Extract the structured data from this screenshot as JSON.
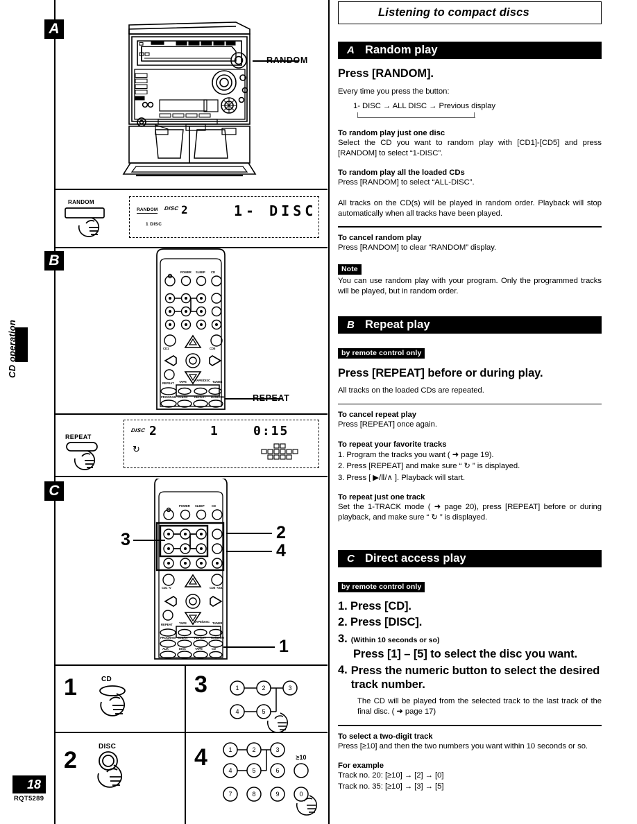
{
  "page": {
    "number": "18",
    "code": "RQT5289",
    "side_label": "CD operation",
    "title": "Listening to compact discs"
  },
  "figures": {
    "a": {
      "letter": "A",
      "callout": "RANDOM",
      "display": {
        "button_label": "RANDOM",
        "indicator": "RANDOM",
        "disc_label": "DISC",
        "disc_number": "2",
        "sub_label": "1 DISC",
        "readout": "1- DISC"
      }
    },
    "b": {
      "letter": "B",
      "callout": "REPEAT",
      "display": {
        "button_label": "REPEAT",
        "disc_label": "DISC",
        "disc_number": "2",
        "track": "1",
        "time": "0:15"
      }
    },
    "c": {
      "letter": "C",
      "markers": [
        "1",
        "2",
        "3",
        "4"
      ]
    },
    "steps": [
      {
        "num": "1",
        "label": "CD"
      },
      {
        "num": "2",
        "label": "DISC"
      },
      {
        "num": "3",
        "label": "",
        "keys": [
          "1",
          "2",
          "3",
          "4",
          "5"
        ]
      },
      {
        "num": "4",
        "label": "",
        "keys": [
          "1",
          "2",
          "3",
          "4",
          "5",
          "6",
          "7",
          "8",
          "9",
          "0"
        ],
        "over10": "≥10"
      }
    ]
  },
  "sections": {
    "random": {
      "letter": "A",
      "name": "Random play",
      "heading": "Press [RANDOM].",
      "intro": "Every time you press the button:",
      "cycle": "1- DISC → ALL DISC → Previous display",
      "sub1_head": "To random play just one  disc",
      "sub1_body": "Select the CD you want to random play with [CD1]-[CD5] and press [RANDOM] to select “1-DISC”.",
      "sub2_head": "To random play all the loaded CDs",
      "sub2_body": "Press [RANDOM] to select “ALL-DISC”.",
      "body3": "All tracks on the CD(s) will be played in random order. Playback will stop automatically when all tracks have been played.",
      "sub3_head": "To cancel random play",
      "sub3_body": "Press [RANDOM] to clear “RANDOM” display.",
      "note_tag": "Note",
      "note_body": "You can use random play with your program. Only the programmed tracks will be played, but in random order."
    },
    "repeat": {
      "letter": "B",
      "name": "Repeat play",
      "tag": "by remote control only",
      "heading": "Press [REPEAT] before or during play.",
      "body": "All tracks on the loaded CDs are repeated.",
      "sub1_head": "To cancel repeat play",
      "sub1_body": "Press [REPEAT] once again.",
      "sub2_head": "To repeat your favorite tracks",
      "sub2_l1": "1. Program the tracks you want ( ➜ page 19).",
      "sub2_l2": "2. Press [REPEAT] and make sure “ ↻ ” is displayed.",
      "sub2_l3": "3. Press [ ▶/Ⅱ/∧ ]. Playback will start.",
      "sub3_head": "To repeat just one track",
      "sub3_body": "Set the 1-TRACK mode ( ➜ page 20), press [REPEAT] before or during playback, and make sure “ ↻ ” is displayed."
    },
    "direct": {
      "letter": "C",
      "name": "Direct access play",
      "tag": "by remote control only",
      "step1": "1. Press [CD].",
      "step2": "2. Press [DISC].",
      "step3_num": "3.",
      "step3_note": "(Within 10 seconds or so)",
      "step3_text": "Press [1] – [5] to select the disc you want.",
      "step4_num": "4.",
      "step4_text": "Press the numeric button to select the desired track number.",
      "step4_body": "The CD will be played from the selected track to the last track of the final disc. ( ➜ page 17)",
      "sub1_head": "To select a two-digit track",
      "sub1_body": "Press [≥10] and then the two numbers you want within 10 seconds or so.",
      "sub2_head": "For example",
      "sub2_l1": "Track no. 20: [≥10] → [2] → [0]",
      "sub2_l2": "Track no. 35: [≥10] → [3] → [5]"
    }
  }
}
